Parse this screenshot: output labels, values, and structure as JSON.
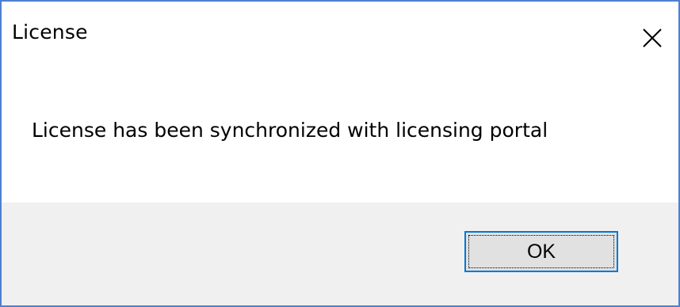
{
  "window": {
    "title": "License",
    "close_icon": "close-icon"
  },
  "message": {
    "text": "License has been synchronized with licensing portal"
  },
  "buttons": {
    "ok_label": "OK"
  },
  "colors": {
    "border": "#4e7fd1",
    "footer_background": "#f0f0f0",
    "button_background": "#e1e1e1",
    "button_focus_border": "#0078d7"
  }
}
